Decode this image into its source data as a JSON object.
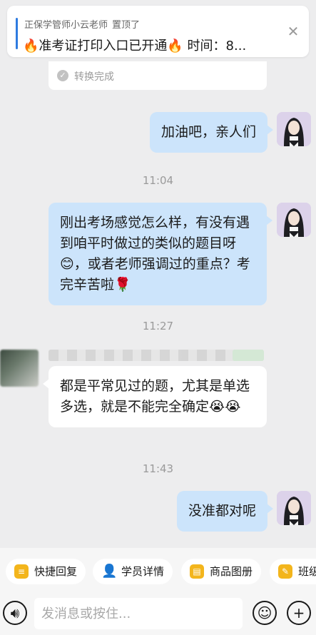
{
  "pinned": {
    "author": "正保学管师小云老师",
    "status": "置顶了",
    "text": "🔥准考证打印入口已开通🔥 时间：8..."
  },
  "convert_card": {
    "label": "转换完成"
  },
  "timestamps": [
    "11:04",
    "11:27",
    "11:43"
  ],
  "messages": [
    {
      "side": "out",
      "text": "加油吧，亲人们"
    },
    {
      "side": "out",
      "text": "刚出考场感觉怎么样，有没有遇到咱平时做过的类似的题目呀😊，或者老师强调过的重点？考完辛苦啦🌹"
    },
    {
      "side": "in",
      "text": "都是平常见过的题，尤其是单选多选，就是不能完全确定😭😭"
    },
    {
      "side": "out",
      "text": "没准都对呢"
    }
  ],
  "quick_actions": [
    {
      "label": "快捷回复",
      "icon": "quick-reply-icon"
    },
    {
      "label": "学员详情",
      "icon": "student-icon"
    },
    {
      "label": "商品图册",
      "icon": "album-icon"
    },
    {
      "label": "班级",
      "icon": "class-icon"
    }
  ],
  "input": {
    "placeholder": "发消息或按住..."
  },
  "colors": {
    "outgoing_bubble": "#cce4fb",
    "incoming_bubble": "#ffffff",
    "pin_accent": "#2e7be0",
    "chip_icon": "#f3b51c"
  }
}
